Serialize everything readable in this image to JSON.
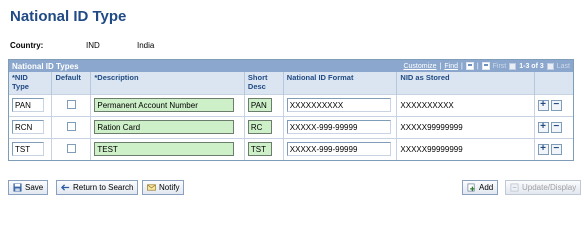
{
  "page": {
    "title": "National ID Type"
  },
  "country": {
    "label": "Country:",
    "code": "IND",
    "name": "India"
  },
  "grid": {
    "title": "National ID Types",
    "customize": "Customize",
    "find": "Find",
    "first": "First",
    "range": "1-3 of 3",
    "last": "Last",
    "columns": {
      "nid_type": "*NID\nType",
      "default": "Default",
      "description": "*Description",
      "short_desc": "Short\nDesc",
      "format": "National ID Format",
      "stored": "NID as Stored"
    },
    "rows": [
      {
        "nid_type": "PAN",
        "default": false,
        "description": "Permanent Account Number",
        "short_desc": "PAN",
        "format": "XXXXXXXXXX",
        "stored": "XXXXXXXXXX"
      },
      {
        "nid_type": "RCN",
        "default": false,
        "description": "Ration Card",
        "short_desc": "RC",
        "format": "XXXXX-999-99999",
        "stored": "XXXXX99999999"
      },
      {
        "nid_type": "TST",
        "default": false,
        "description": "TEST",
        "short_desc": "TST",
        "format": "XXXXX-999-99999",
        "stored": "XXXXX99999999"
      }
    ]
  },
  "buttons": {
    "save": "Save",
    "return_to_search": "Return to Search",
    "notify": "Notify",
    "add": "Add",
    "update_display": "Update/Display"
  },
  "icons": {
    "save": "save-icon",
    "return": "return-icon",
    "notify": "notify-icon",
    "add": "add-icon",
    "update": "update-icon",
    "view_all": "view-all-icon",
    "download": "download-icon",
    "prev": "prev-arrow-icon",
    "next": "next-arrow-icon",
    "row_add": "plus-icon",
    "row_delete": "minus-icon"
  },
  "colors": {
    "title": "#1f4a84",
    "grid_header": "#8ba7cd",
    "column_header": "#dbe5f1",
    "required_field": "#cdf0c8"
  }
}
